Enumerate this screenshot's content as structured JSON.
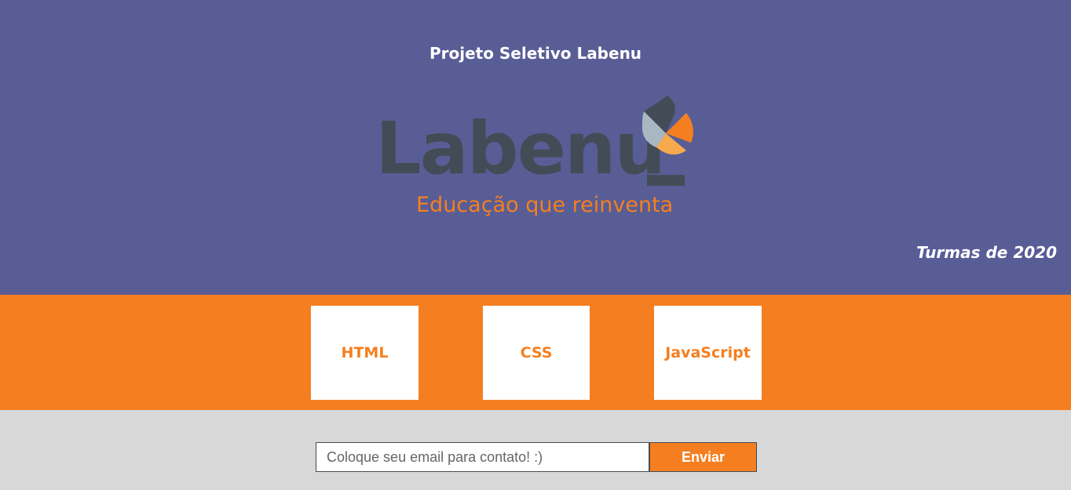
{
  "header": {
    "title": "Projeto Seletivo Labenu",
    "subtitle": "Turmas de 2020",
    "background_color": "#585d96"
  },
  "logo": {
    "wordmark": "Labenu",
    "tagline": "Educação que reinventa",
    "mark_icon": "labenu-flame-icon",
    "colors": {
      "dark": "#434c56",
      "orange": "#f57f20",
      "light_orange": "#f7a94e",
      "grey_blue": "#a8b8c2"
    }
  },
  "topics": {
    "background_color": "#f57f20",
    "items": [
      {
        "label": "HTML"
      },
      {
        "label": "CSS"
      },
      {
        "label": "JavaScript"
      }
    ]
  },
  "contact": {
    "email_placeholder": "Coloque seu email para contato! :)",
    "email_value": "",
    "submit_label": "Enviar"
  }
}
